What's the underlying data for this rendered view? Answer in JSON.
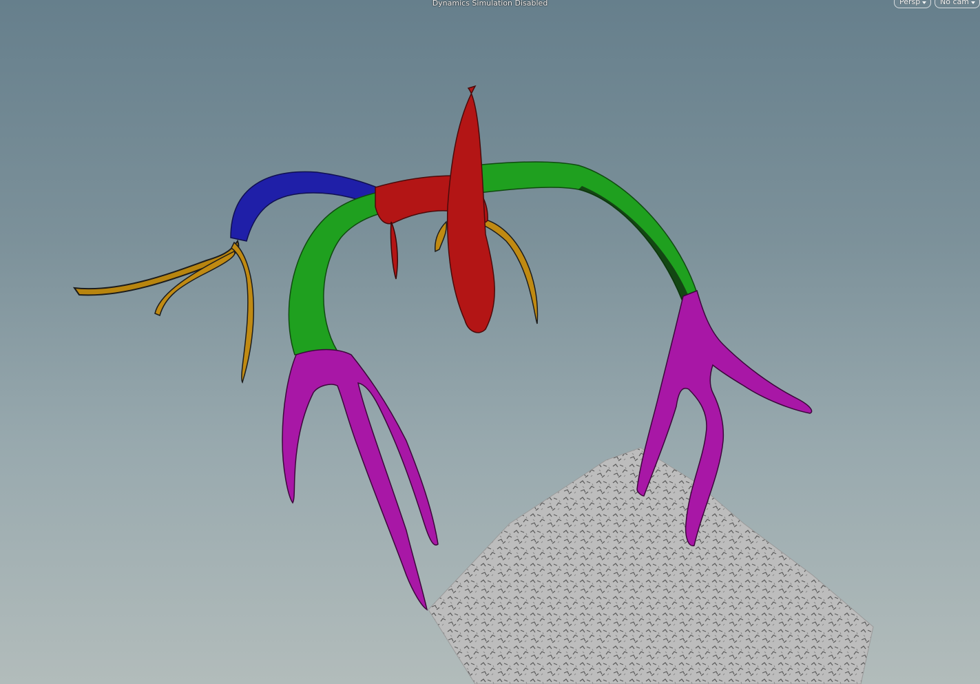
{
  "viewport": {
    "status_text": "Dynamics Simulation Disabled",
    "view_menu_label": "Persp",
    "camera_menu_label": "No cam"
  },
  "scene": {
    "object": "antler",
    "segment_colors": {
      "tips": "#a817a6",
      "mid_branches": "#1fa01f",
      "left_upper": "#1f1fa8",
      "center": "#b31515",
      "side_tines": "#c08a12",
      "terrain": "#bfbfbf"
    }
  }
}
